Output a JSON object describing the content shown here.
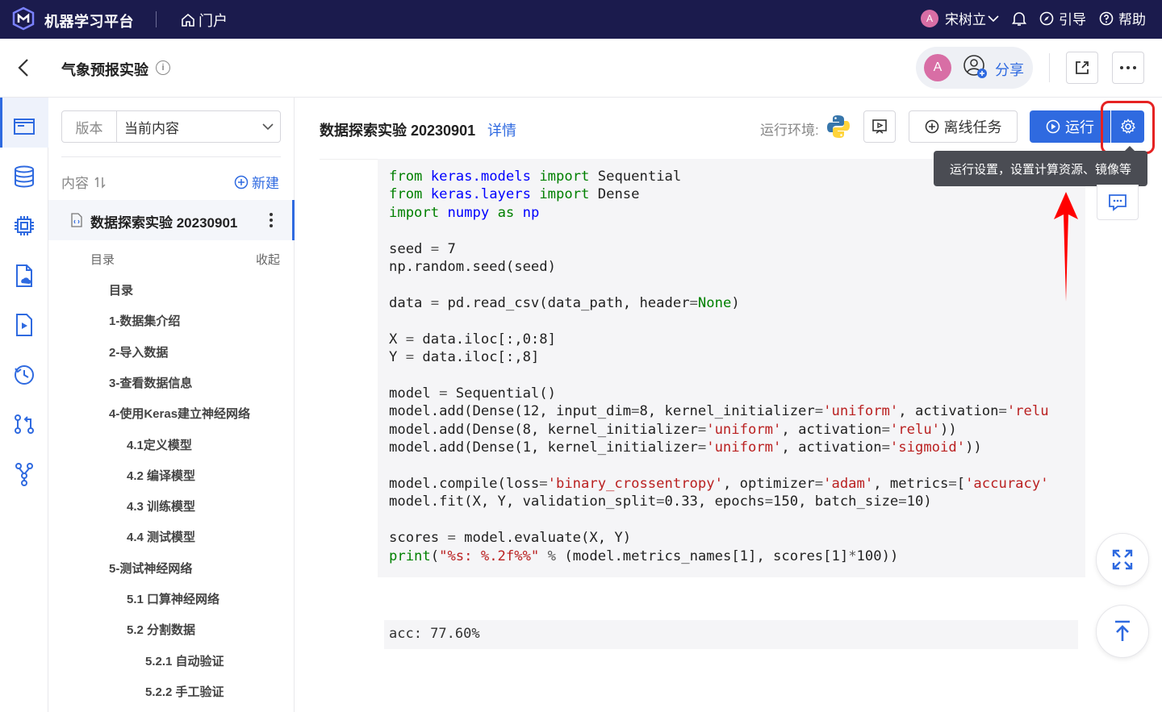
{
  "topbar": {
    "app_title": "机器学习平台",
    "portal": "门户",
    "user_initial": "A",
    "user_name": "宋树立",
    "guide": "引导",
    "help": "帮助"
  },
  "header": {
    "title": "气象预报实验",
    "share_avatar": "A",
    "share_label": "分享"
  },
  "sidebar": {
    "version_label": "版本",
    "version_value": "当前内容",
    "content_label": "内容",
    "new_label": "新建",
    "file_name": "数据探索实验 20230901",
    "toc_head": "目录",
    "toc_collapse": "收起",
    "toc": [
      {
        "label": "目录",
        "level": 1
      },
      {
        "label": "1-数据集介绍",
        "level": 1
      },
      {
        "label": "2-导入数据",
        "level": 1
      },
      {
        "label": "3-查看数据信息",
        "level": 1
      },
      {
        "label": "4-使用Keras建立神经网络",
        "level": 1
      },
      {
        "label": "4.1定义模型",
        "level": 2
      },
      {
        "label": "4.2 编译模型",
        "level": 2
      },
      {
        "label": "4.3 训练模型",
        "level": 2
      },
      {
        "label": "4.4 测试模型",
        "level": 2
      },
      {
        "label": "5-测试神经网络",
        "level": 1
      },
      {
        "label": "5.1 口算神经网络",
        "level": 2
      },
      {
        "label": "5.2 分割数据",
        "level": 2
      },
      {
        "label": "5.2.1 自动验证",
        "level": 3
      },
      {
        "label": "5.2.2 手工验证",
        "level": 3
      }
    ]
  },
  "notebook": {
    "title": "数据探索实验 20230901",
    "detail": "详情",
    "env_label": "运行环境:",
    "offline_task": "离线任务",
    "run": "运行",
    "tooltip": "运行设置，设置计算资源、镜像等",
    "output": "acc: 77.60%"
  },
  "colors": {
    "topbar": "#1b1b4d",
    "accent": "#2f6ae0",
    "highlight": "#e52222"
  }
}
